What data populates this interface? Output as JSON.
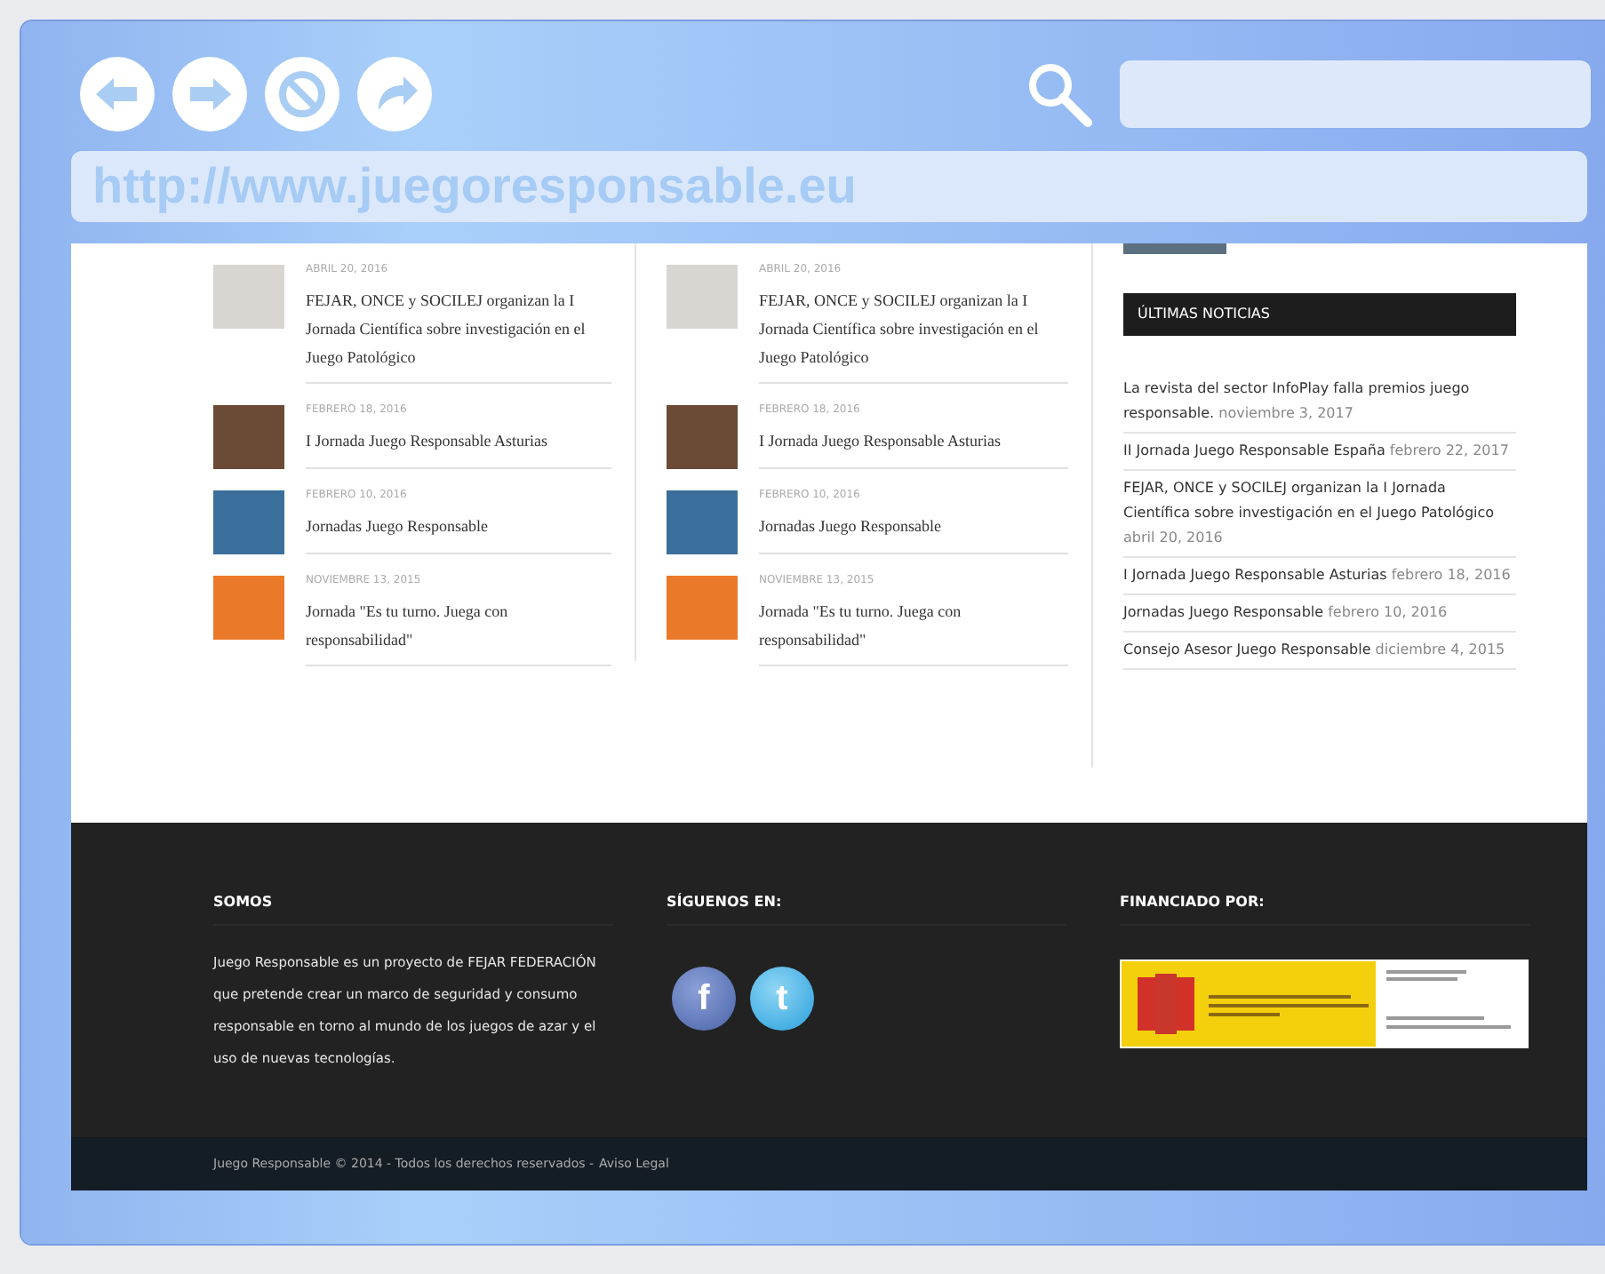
{
  "browser": {
    "url": "http://www.juegoresponsable.eu"
  },
  "columns": [
    {
      "items": [
        {
          "date": "ABRIL 20, 2016",
          "title": "FEJAR, ONCE y SOCILEJ organizan la I Jornada Científica sobre investigación en el Juego Patológico",
          "color": "#d9d6d2"
        },
        {
          "date": "FEBRERO 18, 2016",
          "title": "I Jornada Juego Responsable Asturias",
          "color": "#6b4a36"
        },
        {
          "date": "FEBRERO 10, 2016",
          "title": "Jornadas Juego Responsable",
          "color": "#3a6f9c"
        },
        {
          "date": "NOVIEMBRE 13, 2015",
          "title": "Jornada \"Es tu turno. Juega con responsabilidad\"",
          "color": "#ea7a2a"
        }
      ]
    },
    {
      "items": [
        {
          "date": "ABRIL 20, 2016",
          "title": "FEJAR, ONCE y SOCILEJ organizan la I Jornada Científica sobre investigación en el Juego Patológico",
          "color": "#d9d6d2"
        },
        {
          "date": "FEBRERO 18, 2016",
          "title": "I Jornada Juego Responsable Asturias",
          "color": "#6b4a36"
        },
        {
          "date": "FEBRERO 10, 2016",
          "title": "Jornadas Juego Responsable",
          "color": "#3a6f9c"
        },
        {
          "date": "NOVIEMBRE 13, 2015",
          "title": "Jornada \"Es tu turno. Juega con responsabilidad\"",
          "color": "#ea7a2a"
        }
      ]
    }
  ],
  "sidebar": {
    "heading": "ÚLTIMAS NOTICIAS",
    "news": [
      {
        "title": "La revista del sector InfoPlay falla premios juego responsable.",
        "date": "noviembre 3, 2017"
      },
      {
        "title": "II Jornada Juego Responsable España",
        "date": "febrero 22, 2017"
      },
      {
        "title": "FEJAR, ONCE y SOCILEJ organizan la I Jornada Científica sobre investigación en el Juego Patológico",
        "date": "abril 20, 2016"
      },
      {
        "title": "I Jornada Juego Responsable Asturias",
        "date": "febrero 18, 2016"
      },
      {
        "title": "Jornadas Juego Responsable",
        "date": "febrero 10, 2016"
      },
      {
        "title": "Consejo Asesor Juego Responsable",
        "date": "diciembre 4, 2015"
      }
    ]
  },
  "footer": {
    "about": {
      "heading": "SOMOS",
      "text": "Juego Responsable es un proyecto de FEJAR FEDERACIÓN que pretende crear un marco de seguridad y consumo responsable en torno al mundo de los juegos de azar y el uso de nuevas tecnologías."
    },
    "social": {
      "heading": "SÍGUENOS EN:",
      "links": [
        {
          "kind": "facebook",
          "label": "f"
        },
        {
          "kind": "twitter",
          "label": "t"
        }
      ]
    },
    "funding": {
      "heading": "FINANCIADO POR:"
    }
  },
  "bottom_bar": {
    "copyright": "Juego Responsable © 2014 - Todos los derechos reservados -",
    "link": "Aviso Legal"
  }
}
